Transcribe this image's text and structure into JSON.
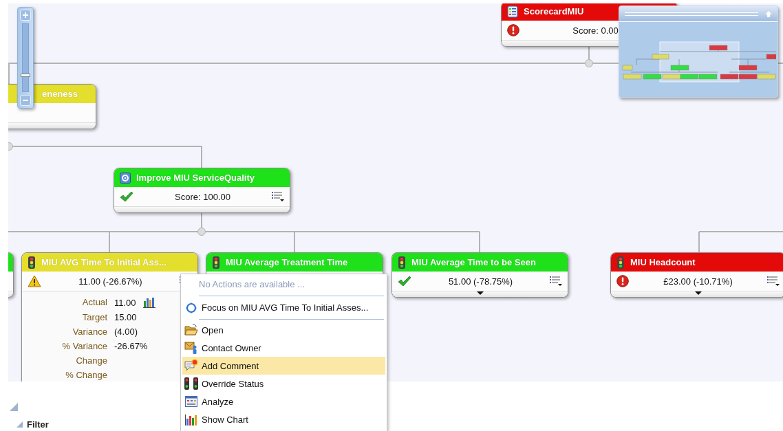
{
  "zoom_control": {
    "level": 0.27
  },
  "nodes": [
    {
      "color": "#e4de2c",
      "title": "eneness"
    },
    {
      "kind": "scorecard",
      "color": "#e40a0a",
      "title": "ScorecardMIU",
      "value": "Score: 0.00"
    },
    {
      "kind": "objective",
      "color": "#1ee11a",
      "title": "Improve MIU ServiceQuality",
      "value": "Score: 100.00"
    },
    {
      "color": "#1ee11a"
    },
    {
      "kind": "kpi",
      "color": "#e4de2c",
      "title": "MIU AVG Time To Initial Ass...",
      "value": "11.00 (-26.67%)",
      "expanded": true,
      "details": [
        {
          "label": "Actual",
          "value": "11.00",
          "chart": true
        },
        {
          "label": "Target",
          "value": "15.00"
        },
        {
          "label": "Variance",
          "value": "(4.00)"
        },
        {
          "label": "% Variance",
          "value": "-26.67%"
        },
        {
          "label": "Change"
        },
        {
          "label": "% Change"
        }
      ]
    },
    {
      "kind": "kpi",
      "color": "#1ee11a",
      "title": "MIU Average Treatment Time"
    },
    {
      "kind": "kpi",
      "color": "#1ee11a",
      "title": "MIU Average Time to be Seen",
      "value": "51.00 (-78.75%)",
      "expanded": false
    },
    {
      "kind": "kpi",
      "color": "#e40a0a",
      "title": "MIU Headcount",
      "value": "£23.00 (-10.71%)",
      "expanded": false
    }
  ],
  "context_menu": {
    "items": [
      {
        "kind": "info",
        "label": "No Actions are available ...",
        "disabled": true
      },
      {
        "kind": "separator"
      },
      {
        "kind": "focus",
        "label": "Focus on MIU AVG Time To Initial Asses...",
        "selected": false
      },
      {
        "kind": "separator"
      },
      {
        "kind": "open",
        "label": "Open",
        "selected": false
      },
      {
        "kind": "contact",
        "label": "Contact Owner",
        "selected": false
      },
      {
        "kind": "comment",
        "label": "Add Comment",
        "selected": true
      },
      {
        "kind": "override",
        "label": "Override Status",
        "selected": false
      },
      {
        "kind": "analyze",
        "label": "Analyze",
        "selected": false
      },
      {
        "kind": "chart",
        "label": "Show Chart",
        "selected": false
      }
    ]
  },
  "filter": {
    "label": "Filter"
  }
}
